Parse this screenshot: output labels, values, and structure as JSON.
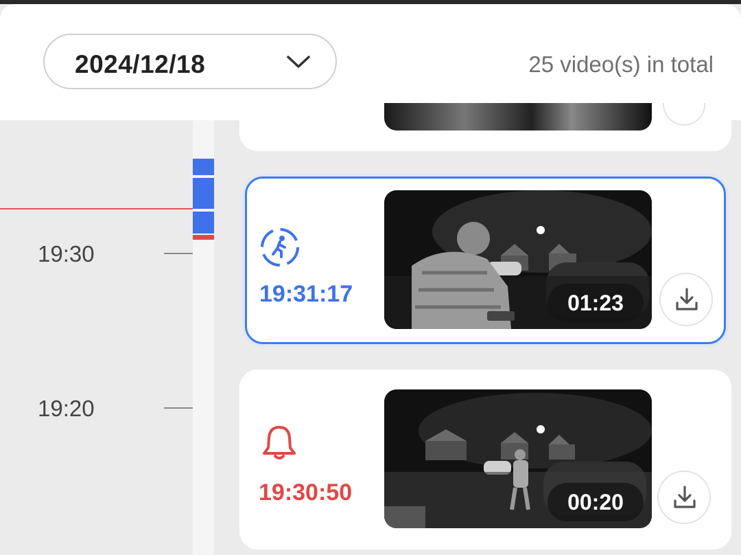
{
  "header": {
    "date_value": "2024/12/18",
    "total_text": "25 video(s) in total"
  },
  "timeline": {
    "labels": [
      "19:30",
      "19:20"
    ]
  },
  "colors": {
    "accent": "#3f72e8",
    "alert": "#e04848"
  },
  "events": [
    {
      "type": "motion",
      "icon": "motion-person-icon",
      "time": "19:31:17",
      "duration": "01:23",
      "selected": true
    },
    {
      "type": "doorbell",
      "icon": "bell-icon",
      "time": "19:30:50",
      "duration": "00:20",
      "selected": false
    }
  ]
}
